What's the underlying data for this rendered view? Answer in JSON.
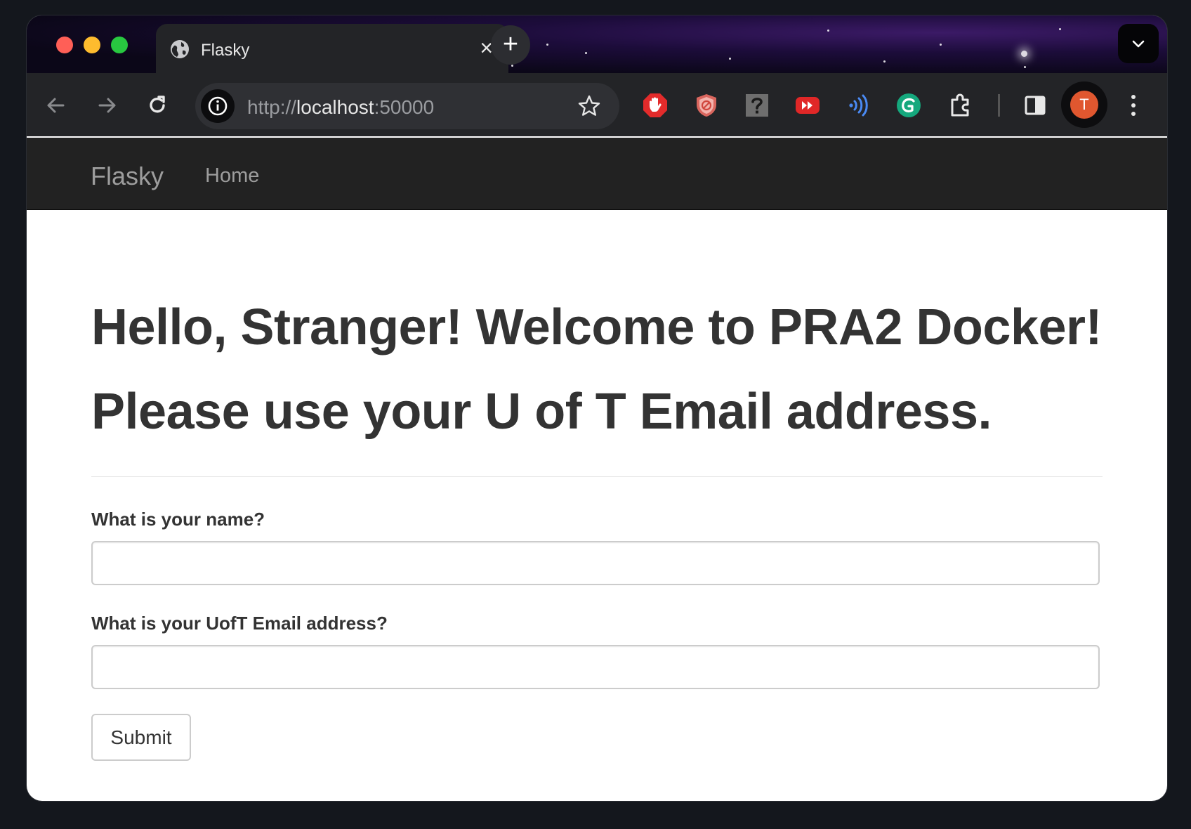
{
  "browser": {
    "tab_title": "Flasky",
    "tab_close": "×",
    "new_tab": "+",
    "url_scheme": "http://",
    "url_host": "localhost",
    "url_port": ":50000",
    "profile_initial": "T",
    "theme_colors": {
      "tab_strip": "#0b0718",
      "toolbar": "#232427",
      "avatar": "#e0572f"
    },
    "extensions": [
      "adblock-hand-icon",
      "shield-block-icon",
      "question-icon",
      "youtube-forward-icon",
      "audio-waves-icon",
      "grammarly-icon",
      "puzzle-extensions-icon"
    ]
  },
  "navbar": {
    "brand": "Flasky",
    "links": [
      "Home"
    ]
  },
  "page": {
    "heading_line1": "Hello, Stranger! Welcome to PRA2 Docker!",
    "heading_line2": "Please use your U of T Email address.",
    "form": {
      "name_label": "What is your name?",
      "name_value": "",
      "email_label": "What is your UofT Email address?",
      "email_value": "",
      "submit_label": "Submit"
    }
  }
}
